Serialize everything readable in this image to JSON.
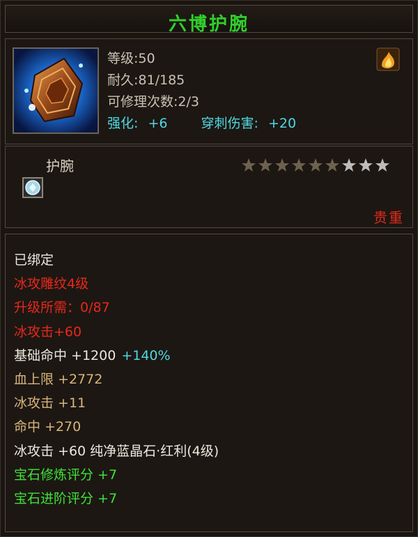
{
  "item": {
    "name": "六博护腕",
    "level": "等级:50",
    "durability": "耐久:81/185",
    "repair_count": "可修理次数:2/3",
    "enhance_label": "强化:",
    "enhance_value": "+6",
    "pierce_label": "穿刺伤害:",
    "pierce_value": "+20",
    "type": "护腕",
    "stars_filled": 6,
    "stars_total": 9,
    "rarity": "贵重",
    "icon": "bracer-item-icon",
    "badge_icon": "flame-emblem-icon",
    "gem_icon": "crystal-gem-icon"
  },
  "attributes": [
    {
      "text": "已绑定",
      "color": "white"
    },
    {
      "text": "冰攻雕纹4级",
      "color": "red"
    },
    {
      "text": "升级所需：0/87",
      "color": "red"
    },
    {
      "text": "冰攻击+60",
      "color": "red"
    },
    {
      "label": "基础命中 +1200",
      "extra": "+140%",
      "color": "white"
    },
    {
      "text": "血上限 +2772",
      "color": "gold"
    },
    {
      "text": "冰攻击 +11",
      "color": "gold"
    },
    {
      "text": "命中 +270",
      "color": "gold"
    },
    {
      "text": "冰攻击 +60 纯净蓝晶石·红利(4级)",
      "color": "white"
    },
    {
      "text": "宝石修炼评分 +7",
      "color": "green"
    },
    {
      "text": "宝石进阶评分 +7",
      "color": "green"
    }
  ],
  "colors": {
    "title": "#2fd02a",
    "red": "#e8281a",
    "gold": "#d9b47a",
    "green": "#3ee237",
    "cyan": "#4fd8e0",
    "star_filled": "#6e624e",
    "star_empty": "#bdbdbd"
  }
}
